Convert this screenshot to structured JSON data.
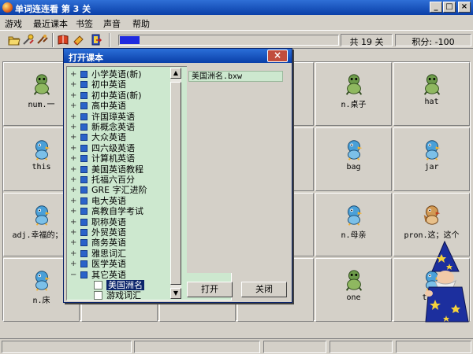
{
  "window": {
    "title": "单词连连看  第 3 关",
    "controls": {
      "minimize": "_",
      "maximize": "□",
      "close": "×"
    }
  },
  "menu": [
    "游戏",
    "最近课本",
    "书签",
    "声音",
    "帮助"
  ],
  "toolbar": {
    "progress": 0.09,
    "count_label": "共 19 关",
    "score_label": "积分: -100"
  },
  "cards": [
    {
      "word": "num.一",
      "critter": "green-turtle"
    },
    {
      "word": "",
      "critter": ""
    },
    {
      "word": "",
      "critter": ""
    },
    {
      "word": "",
      "critter": ""
    },
    {
      "word": "n.桌子",
      "critter": "green-turtle"
    },
    {
      "word": "hat",
      "critter": "green-turtle"
    },
    {
      "word": "this",
      "critter": "blue-bird"
    },
    {
      "word": "",
      "critter": ""
    },
    {
      "word": "",
      "critter": ""
    },
    {
      "word": "",
      "critter": ""
    },
    {
      "word": "bag",
      "critter": "blue-bird"
    },
    {
      "word": "jar",
      "critter": "blue-bird"
    },
    {
      "word": "adj.幸福的；快",
      "critter": "blue-bird"
    },
    {
      "word": "",
      "critter": ""
    },
    {
      "word": "",
      "critter": ""
    },
    {
      "word": "",
      "critter": ""
    },
    {
      "word": "n.母亲",
      "critter": "blue-bird"
    },
    {
      "word": "pron.这；这个",
      "critter": "brown-bird"
    },
    {
      "word": "n.床",
      "critter": "blue-bird"
    },
    {
      "word": "",
      "critter": ""
    },
    {
      "word": "",
      "critter": ""
    },
    {
      "word": "",
      "critter": ""
    },
    {
      "word": "one",
      "critter": "green-turtle"
    },
    {
      "word": "tabl",
      "critter": "blue-bird"
    }
  ],
  "dialog": {
    "title": "打开课本",
    "close_glyph": "×",
    "tree": [
      {
        "label": "小学英语(新)",
        "expander": "+"
      },
      {
        "label": "初中英语",
        "expander": "+"
      },
      {
        "label": "初中英语(新)",
        "expander": "+"
      },
      {
        "label": "高中英语",
        "expander": "+"
      },
      {
        "label": "许国璋英语",
        "expander": "+"
      },
      {
        "label": "新概念英语",
        "expander": "+"
      },
      {
        "label": "大众英语",
        "expander": "+"
      },
      {
        "label": "四六级英语",
        "expander": "+"
      },
      {
        "label": "计算机英语",
        "expander": "+"
      },
      {
        "label": "美国英语教程",
        "expander": "+"
      },
      {
        "label": "托福六百分",
        "expander": "+"
      },
      {
        "label": "GRE 字汇进阶",
        "expander": "+"
      },
      {
        "label": "电大英语",
        "expander": "+"
      },
      {
        "label": "高教自学考试",
        "expander": "+"
      },
      {
        "label": "职称英语",
        "expander": "+"
      },
      {
        "label": "外贸英语",
        "expander": "+"
      },
      {
        "label": "商务英语",
        "expander": "+"
      },
      {
        "label": "雅思词汇",
        "expander": "+"
      },
      {
        "label": "医学英语",
        "expander": "+"
      },
      {
        "label": "其它英语",
        "expander": "−"
      }
    ],
    "children": [
      {
        "label": "美国洲名",
        "selected": true
      },
      {
        "label": "游戏词汇",
        "selected": false
      }
    ],
    "file": "美国洲名.bxw",
    "open_label": "打开",
    "close_label": "关闭"
  }
}
